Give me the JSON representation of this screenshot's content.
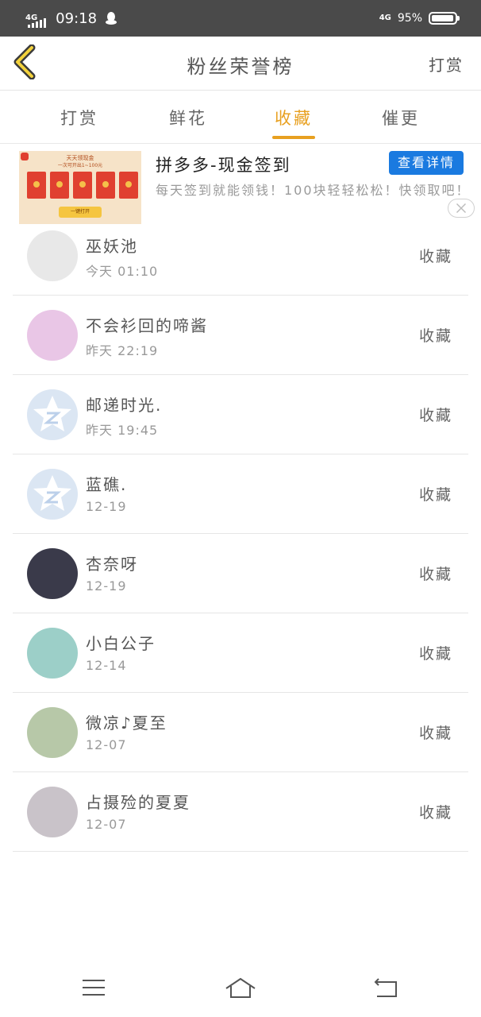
{
  "status_bar": {
    "network_left": "4G",
    "time": "09:18",
    "network_right": "4G",
    "battery_percent_text": "95%",
    "battery_level": 0.95
  },
  "header": {
    "title": "粉丝荣誉榜",
    "action_label": "打赏"
  },
  "tabs": [
    {
      "label": "打赏",
      "active": false
    },
    {
      "label": "鲜花",
      "active": false
    },
    {
      "label": "收藏",
      "active": true
    },
    {
      "label": "催更",
      "active": false
    }
  ],
  "ad": {
    "title": "拼多多-现金签到",
    "button_label": "查看详情",
    "description": "每天签到就能领钱！100块轻轻松松！快领取吧！",
    "image_title": "天天领现金",
    "image_subtitle": "一次可开出1~100元",
    "image_button": "一键打开"
  },
  "list": [
    {
      "name": "巫妖池",
      "time": "今天 01:10",
      "action": "收藏",
      "avatar_color": "#e8e8e8"
    },
    {
      "name": "不会衫回的啼酱",
      "time": "昨天 22:19",
      "action": "收藏",
      "avatar_color": "#e9c6e6"
    },
    {
      "name": "邮递时光.",
      "time": "昨天 19:45",
      "action": "收藏",
      "avatar_color": "#dbe6f3"
    },
    {
      "name": "蓝礁.",
      "time": "12-19",
      "action": "收藏",
      "avatar_color": "#dbe6f3"
    },
    {
      "name": "杏奈呀",
      "time": "12-19",
      "action": "收藏",
      "avatar_color": "#3a3a4a"
    },
    {
      "name": "小白公子",
      "time": "12-14",
      "action": "收藏",
      "avatar_color": "#9ccfc8"
    },
    {
      "name": "微凉♪夏至",
      "time": "12-07",
      "action": "收藏",
      "avatar_color": "#b7c8a8"
    },
    {
      "name": "占摄殓的夏夏",
      "time": "12-07",
      "action": "收藏",
      "avatar_color": "#c9c3c9"
    }
  ],
  "colors": {
    "accent": "#e8a020",
    "ad_button": "#1a7ae0",
    "status_bar": "#4a4a4a"
  }
}
